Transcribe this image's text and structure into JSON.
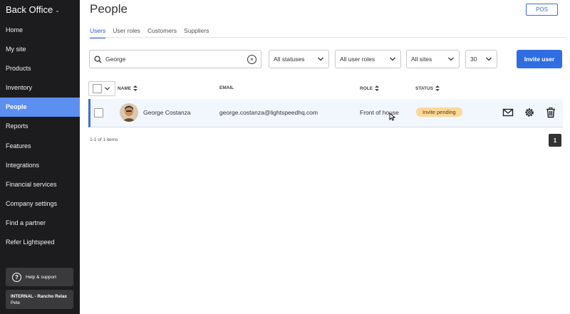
{
  "app": {
    "brand": "Back Office",
    "nav": [
      "Home",
      "My site",
      "Products",
      "Inventory",
      "People",
      "Reports",
      "Features",
      "Integrations",
      "Financial services",
      "Company settings",
      "Find a partner",
      "Refer Lightspeed"
    ],
    "active_nav": "People",
    "help_label": "Help & support",
    "account_name": "INTERNAL - Rancho Relax",
    "account_user": "Pete"
  },
  "page": {
    "title": "People",
    "pos_button": "POS",
    "tabs": [
      "Users",
      "User roles",
      "Customers",
      "Suppliers"
    ],
    "active_tab": "Users"
  },
  "filters": {
    "search_value": "George",
    "status": "All statuses",
    "roles": "All user roles",
    "sites": "All sites",
    "per_page": "30",
    "invite_button": "Invite user"
  },
  "table": {
    "columns": [
      "NAME",
      "EMAIL",
      "ROLE",
      "STATUS"
    ],
    "rows": [
      {
        "name": "George Costanza",
        "email": "george.costanza@lightspeedhq.com",
        "role": "Front of house",
        "status": "Invite pending"
      }
    ],
    "items_summary": "1-1 of 1 items",
    "current_page": "1"
  },
  "colors": {
    "sidebar_bg": "#1c1c1e",
    "active_nav": "#5c8ff0",
    "accent": "#2f6de0",
    "badge_pending": "#fbd89a"
  }
}
